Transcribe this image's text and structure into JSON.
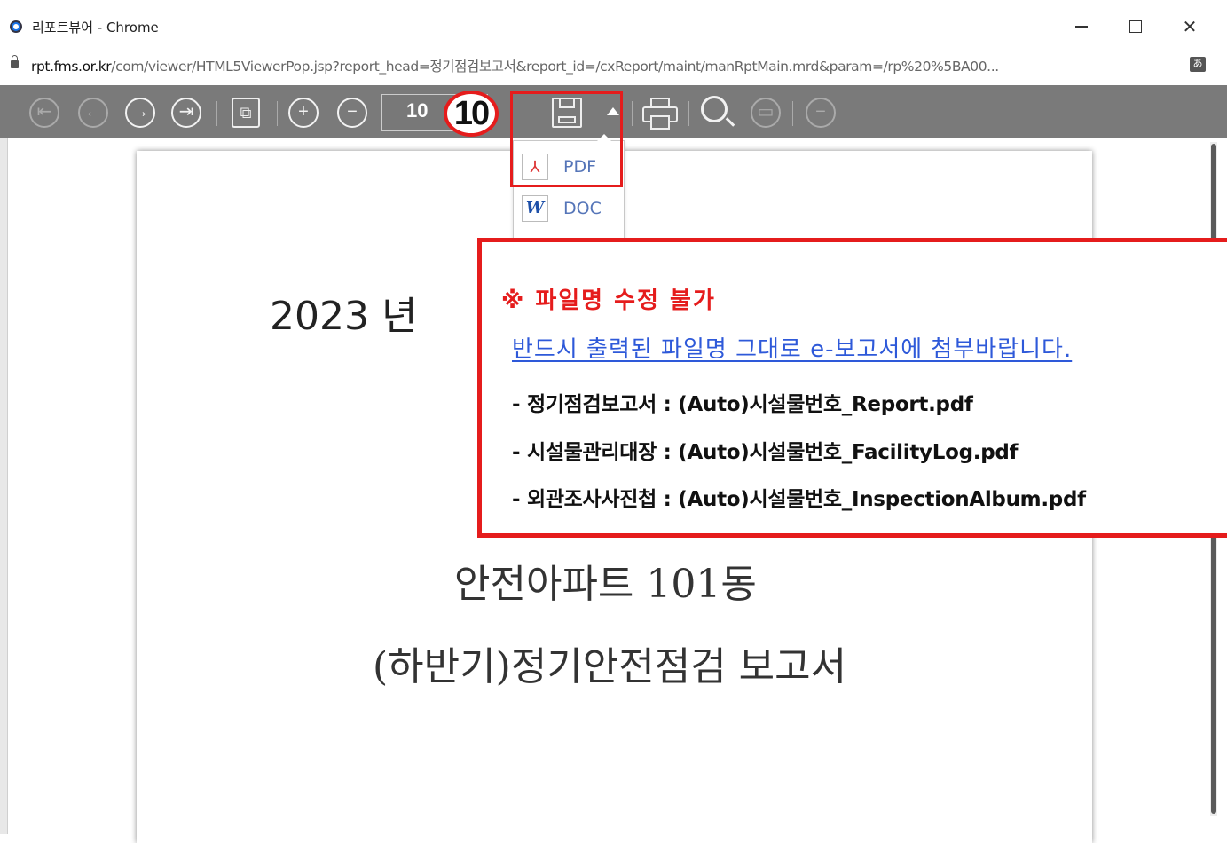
{
  "window": {
    "title": "리포트뷰어 - Chrome",
    "url_host": "rpt.fms.or.kr",
    "url_rest": "/com/viewer/HTML5ViewerPop.jsp?report_head=정기점검보고서&report_id=/cxReport/maint/manRptMain.mrd&param=/rp%20%5BA00..."
  },
  "toolbar": {
    "page_value": "10",
    "step_badge": "10"
  },
  "icons": {
    "first": "first-page-icon",
    "prev": "prev-page-icon",
    "next": "next-page-icon",
    "last": "last-page-icon",
    "export": "export-icon",
    "zoom_in": "zoom-in-icon",
    "zoom_out": "zoom-out-icon",
    "save": "save-icon",
    "print": "print-icon",
    "search": "search-icon"
  },
  "dropdown": {
    "items": [
      {
        "label": "PDF"
      },
      {
        "label": "DOC"
      }
    ]
  },
  "report": {
    "year": "2023 년",
    "building": "안전아파트 101동",
    "title": "(하반기)정기안전점검 보고서"
  },
  "note": {
    "title": "※ 파일명 수정 불가",
    "subtitle": "반드시 출력된 파일명 그대로 e-보고서에 첨부바랍니다.",
    "lines": [
      "- 정기점검보고서 : (Auto)시설물번호_Report.pdf",
      "- 시설물관리대장 : (Auto)시설물번호_FacilityLog.pdf",
      "- 외관조사사진첩 : (Auto)시설물번호_InspectionAlbum.pdf"
    ]
  },
  "colors": {
    "accent_red": "#e51c1c",
    "link_blue": "#2e59d9",
    "toolbar_gray": "#7a7a7a"
  }
}
